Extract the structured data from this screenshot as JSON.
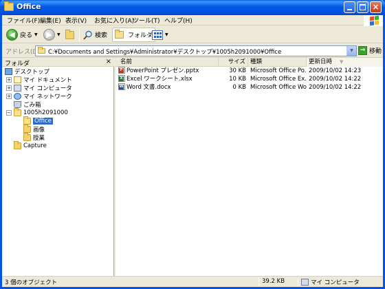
{
  "window": {
    "title": "Office"
  },
  "menu": {
    "items": [
      "ファイル(F)",
      "編集(E)",
      "表示(V)",
      "お気に入り(A)",
      "ツール(T)",
      "ヘルプ(H)"
    ]
  },
  "toolbar": {
    "back_label": "戻る",
    "search_label": "検索",
    "folders_label": "フォルダ"
  },
  "address": {
    "label": "アドレス(D)",
    "value": "C:¥Documents and Settings¥Administrator¥デスクトップ¥1005h2091000¥Office",
    "go_label": "移動"
  },
  "folders_pane": {
    "title": "フォルダ",
    "close": "×",
    "tree": [
      {
        "label": "デスクトップ",
        "icon": "desktop-icon",
        "expander": ""
      },
      {
        "label": "マイ ドキュメント",
        "icon": "my-documents-icon",
        "expander": "+"
      },
      {
        "label": "マイ コンピュータ",
        "icon": "my-computer-icon",
        "expander": "+"
      },
      {
        "label": "マイ ネットワーク",
        "icon": "my-network-icon",
        "expander": "+"
      },
      {
        "label": "ごみ箱",
        "icon": "recycle-bin-icon",
        "expander": ""
      },
      {
        "label": "1005h2091000",
        "icon": "folder-open-icon",
        "expander": "−"
      },
      {
        "label": "Office",
        "icon": "folder-open-icon",
        "expander": "",
        "selected": true
      },
      {
        "label": "画像",
        "icon": "folder-icon",
        "expander": ""
      },
      {
        "label": "授業",
        "icon": "folder-icon",
        "expander": ""
      },
      {
        "label": "Capture",
        "icon": "folder-icon",
        "expander": ""
      }
    ]
  },
  "file_list": {
    "columns": [
      "名前",
      "サイズ",
      "種類",
      "更新日時"
    ],
    "rows": [
      {
        "name": "PowerPoint プレゼン.pptx",
        "size": "30 KB",
        "type": "Microsoft Office Po...",
        "modified": "2009/10/02 14:23",
        "icon": "powerpoint-file-icon",
        "icon_color": "#c8391a",
        "icon_glyph": "P"
      },
      {
        "name": "Excel ワークシート.xlsx",
        "size": "10 KB",
        "type": "Microsoft Office Ex...",
        "modified": "2009/10/02 14:22",
        "icon": "excel-file-icon",
        "icon_color": "#1d7a2e",
        "icon_glyph": "X"
      },
      {
        "name": "Word 文書.docx",
        "size": "0 KB",
        "type": "Microsoft Office Wo...",
        "modified": "2009/10/02 14:22",
        "icon": "word-file-icon",
        "icon_color": "#1f4fb5",
        "icon_glyph": "W"
      }
    ]
  },
  "status": {
    "objects": "3 個のオブジェクト",
    "size": "39.2 KB",
    "location": "マイ コンピュータ"
  }
}
